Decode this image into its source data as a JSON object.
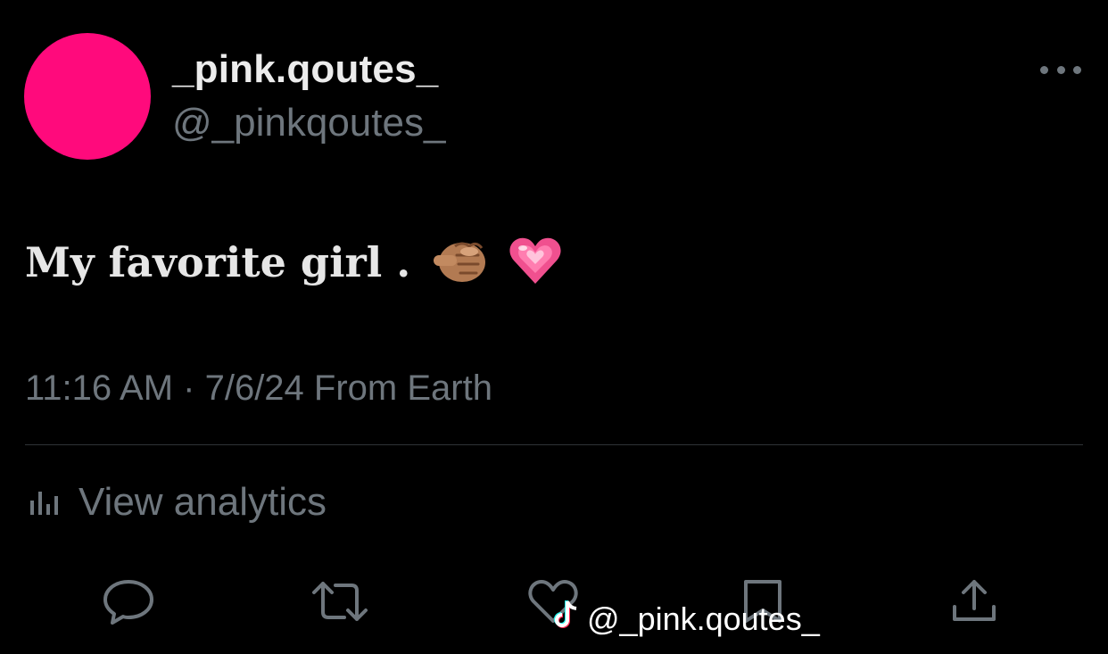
{
  "profile": {
    "display_name": "_pink.qoutes_",
    "handle": "@_pinkqoutes_",
    "avatar_color": "#ff0a7c"
  },
  "tweet": {
    "text": "My favorite girl .",
    "emojis": [
      "pointing-fist-emoji",
      "growing-heart-emoji"
    ]
  },
  "meta": {
    "text": "11:16 AM · 7/6/24 From Earth"
  },
  "analytics": {
    "label": "View analytics"
  },
  "actions": [
    "reply-icon",
    "retweet-icon",
    "like-icon",
    "bookmark-icon",
    "share-icon"
  ],
  "watermark": {
    "text": "@_pink.qoutes_"
  }
}
